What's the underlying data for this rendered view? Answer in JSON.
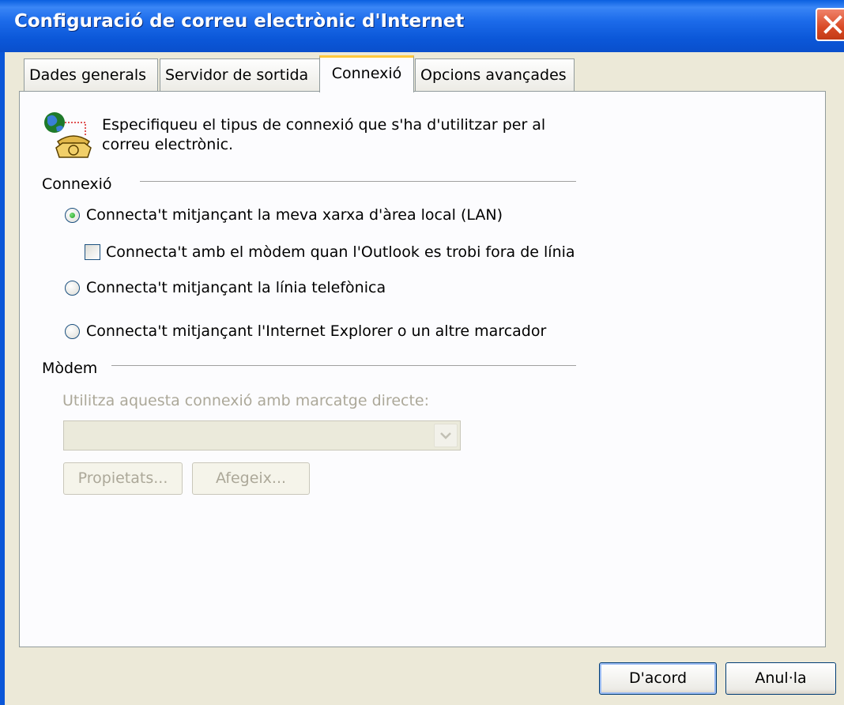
{
  "window": {
    "title": "Configuració de correu electrònic d'Internet"
  },
  "tabs": [
    {
      "label": "Dades generals"
    },
    {
      "label": "Servidor de sortida"
    },
    {
      "label": "Connexió"
    },
    {
      "label": "Opcions avançades"
    }
  ],
  "active_tab": "Connexió",
  "intro": {
    "line1": "Especifiqueu el tipus de connexió que s'ha d'utilitzar per al",
    "line2": "correu electrònic.",
    "icon": "phone-globe-icon"
  },
  "connection_group": {
    "label": "Connexió",
    "options": [
      {
        "label": "Connecta't mitjançant la meva xarxa d'àrea local (LAN)",
        "checked": true
      },
      {
        "label": "Connecta't mitjançant la línia telefònica",
        "checked": false
      },
      {
        "label": "Connecta't mitjançant l'Internet Explorer o un altre marcador",
        "checked": false
      }
    ],
    "modem_checkbox": {
      "label": "Connecta't amb el mòdem quan l'Outlook es trobi fora de línia",
      "checked": false
    }
  },
  "modem_group": {
    "label": "Mòdem",
    "dial_label": "Utilitza aquesta connexió amb marcatge directe:",
    "dial_value": "",
    "properties_button": "Propietats...",
    "add_button": "Afegeix..."
  },
  "footer": {
    "ok": "D'acord",
    "cancel": "Anul·la"
  },
  "colors": {
    "titlebar": "#0b57d8",
    "active_tab_accent": "#ffc83c",
    "background": "#ece9d8"
  }
}
